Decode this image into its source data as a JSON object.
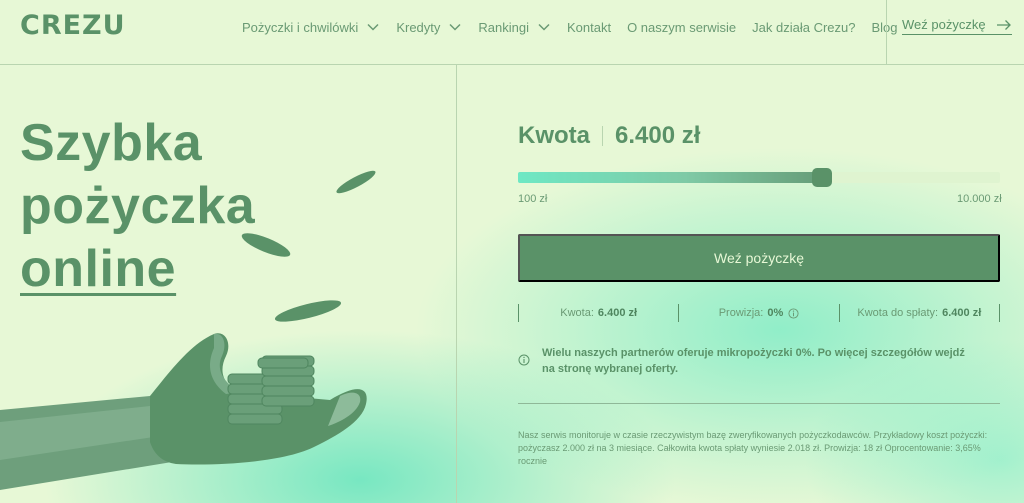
{
  "header": {
    "logo": "CREZU",
    "nav": [
      {
        "label": "Pożyczki i chwilówki",
        "has_dropdown": true
      },
      {
        "label": "Kredyty",
        "has_dropdown": true
      },
      {
        "label": "Rankingi",
        "has_dropdown": true
      },
      {
        "label": "Kontakt",
        "has_dropdown": false
      },
      {
        "label": "O naszym serwisie",
        "has_dropdown": false
      },
      {
        "label": "Jak działa Crezu?",
        "has_dropdown": false
      },
      {
        "label": "Blog",
        "has_dropdown": false
      }
    ],
    "cta_label": "Weź pożyczkę"
  },
  "hero": {
    "line1": "Szybka",
    "line2": "pożyczka",
    "line3": "online"
  },
  "calculator": {
    "amount_label": "Kwota",
    "amount_value": "6.400 zł",
    "slider_fraction": 0.63,
    "range_min": "100 zł",
    "range_max": "10.000 zł",
    "button_label": "Weź pożyczkę",
    "summary": {
      "amount_label": "Kwota:",
      "amount_value": "6.400 zł",
      "fee_label": "Prowizja:",
      "fee_value": "0%",
      "repay_label": "Kwota do spłaty:",
      "repay_value": "6.400 zł"
    },
    "notice": "Wielu naszych partnerów oferuje mikropożyczki 0%. Po więcej szczegółów wejdź na stronę wybranej oferty.",
    "disclaimer": "Nasz serwis monitoruje w czasie rzeczywistym bazę zweryfikowanych pożyczkodawców. Przykładowy koszt pożyczki: pożyczasz 2.000 zł na 3 miesiące. Całkowita kwota spłaty wyniesie 2.018 zł. Prowizja: 18 zł Oprocentowanie: 3,65% rocznie"
  },
  "colors": {
    "background": "#e7f8d6",
    "primary": "#5a9268",
    "accent": "#6ee8c4"
  },
  "icons": [
    "chevron-down-icon",
    "arrow-right-icon",
    "info-icon"
  ]
}
